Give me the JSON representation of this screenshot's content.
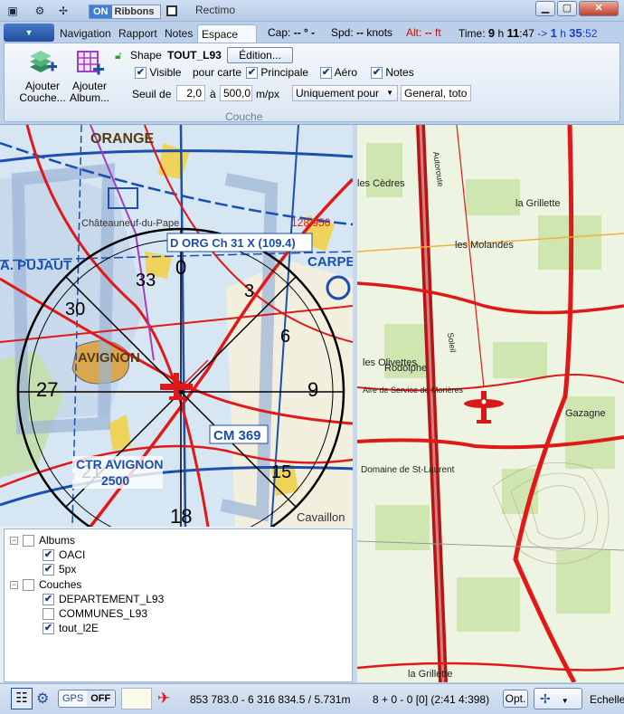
{
  "window": {
    "title": "Rectimo",
    "on_label": "ON",
    "ribbons_label": "Ribbons",
    "minimize": "▁",
    "maximize": "▢",
    "close": "✕"
  },
  "tabs": [
    "Navigation",
    "Rapport",
    "Notes",
    "Espace de T"
  ],
  "flight_info": {
    "cap_label": "Cap:",
    "cap_value": "-- ° -",
    "spd_label": "Spd:",
    "spd_value": "--",
    "spd_unit": "knots",
    "alt_label": "Alt:",
    "alt_value": "--",
    "alt_unit": "ft",
    "time_label": "Time:",
    "time_h1": "9",
    "time_h_unit": "h",
    "time_m1": "11",
    "time_s1": ":47",
    "arrow": "->",
    "time_h2": "1",
    "time_m2": "35",
    "time_s2": ":52"
  },
  "ribbon": {
    "add_layer": "Ajouter Couche...",
    "add_album": "Ajouter Album...",
    "shape_label": "Shape",
    "shape_name": "TOUT_L93",
    "edit_button": "Édition...",
    "visible": "Visible",
    "pour_carte": "pour carte",
    "principale": "Principale",
    "aero": "Aéro",
    "notes": "Notes",
    "seuil_label": "Seuil de",
    "seuil_from": "2,0",
    "seuil_to_label": "à",
    "seuil_to": "500,0",
    "seuil_unit": "m/px",
    "dropdown_value": "Uniquement pour",
    "general_field": "General, toto",
    "group_label": "Couche"
  },
  "map_labels": {
    "orange": "ORANGE",
    "org": "D ORG Ch 31 X (109.4)",
    "freq": "128.950",
    "chateau": "Châteauneuf-du-Pape",
    "pujaut": "A. PUJAUT",
    "avignon": "AVIGNON",
    "ctr": "CTR AVIGNON",
    "ctr_alt": "2500",
    "cm": "CM 369",
    "carpe": "CARPE",
    "cavaillon": "Cavaillon",
    "cedres": "les Cèdres",
    "grillette": "la Grillette",
    "molandes": "les Molandes",
    "olivettes": "les Olivettes",
    "rodolphe": "Rodolphe",
    "aire": "Aire de Service de Morières",
    "gazagne": "Gazagne",
    "domaine": "Domaine de St-Laurent",
    "grillette2": "la Grillette",
    "autoroute": "Autoroute",
    "soleil": "Soleil"
  },
  "layers": {
    "albums_label": "Albums",
    "albums": [
      {
        "name": "OACI",
        "checked": "✔"
      },
      {
        "name": "5px",
        "checked": "✔"
      }
    ],
    "couches_label": "Couches",
    "couches": [
      {
        "name": "DEPARTEMENT_L93",
        "checked": "✔"
      },
      {
        "name": "COMMUNES_L93",
        "checked": ""
      },
      {
        "name": "tout_l2E",
        "checked": "✔"
      }
    ]
  },
  "status": {
    "gps_label": "GPS",
    "gps_state": "OFF",
    "coords": "853 783.0 - 6 316 834.5 / 5.731m",
    "counter": "8 + 0 - 0 [0]  (2:41  4:398)",
    "opt": "Opt.",
    "echelle": "Echelle"
  },
  "colors": {
    "accent_blue": "#1f4f9e",
    "alt_red": "#cc1010",
    "time_blue": "#1c3cc0",
    "route_red": "#e01818"
  }
}
